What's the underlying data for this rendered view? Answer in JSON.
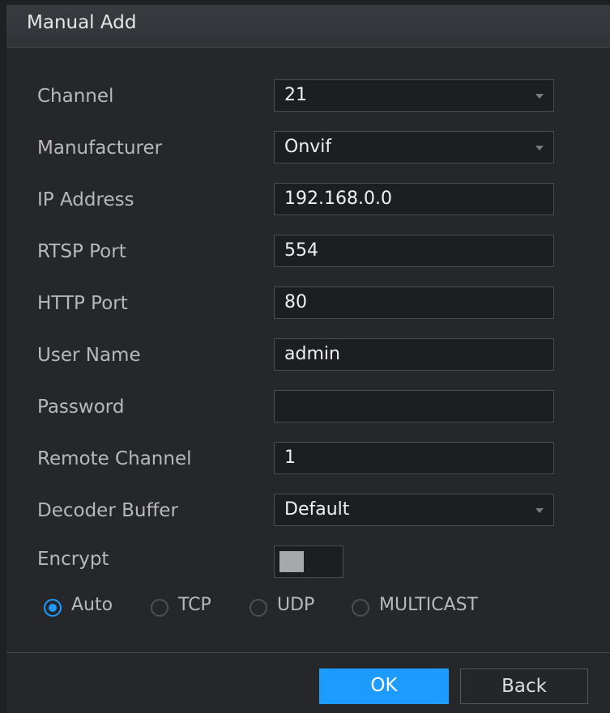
{
  "dialog": {
    "title": "Manual Add"
  },
  "fields": {
    "channel": {
      "label": "Channel",
      "value": "21"
    },
    "manufacturer": {
      "label": "Manufacturer",
      "value": "Onvif"
    },
    "ip_address": {
      "label": "IP Address",
      "value": "192.168.0.0"
    },
    "rtsp_port": {
      "label": "RTSP Port",
      "value": "554"
    },
    "http_port": {
      "label": "HTTP Port",
      "value": "80"
    },
    "user_name": {
      "label": "User Name",
      "value": "admin"
    },
    "password": {
      "label": "Password",
      "value": ""
    },
    "remote_channel": {
      "label": "Remote Channel",
      "value": "1"
    },
    "decoder_buffer": {
      "label": "Decoder Buffer",
      "value": "Default"
    },
    "encrypt": {
      "label": "Encrypt",
      "enabled": false
    }
  },
  "protocol": {
    "selected": "Auto",
    "options": [
      "Auto",
      "TCP",
      "UDP",
      "MULTICAST"
    ]
  },
  "buttons": {
    "ok": "OK",
    "back": "Back"
  },
  "colors": {
    "accent": "#1e9bff",
    "background": "#26272b",
    "field_background": "#1d1e21"
  },
  "icons": {
    "dropdown": "chevron-down-icon",
    "radio_selected": "radio-checked-icon",
    "radio_unselected": "radio-unchecked-icon"
  }
}
